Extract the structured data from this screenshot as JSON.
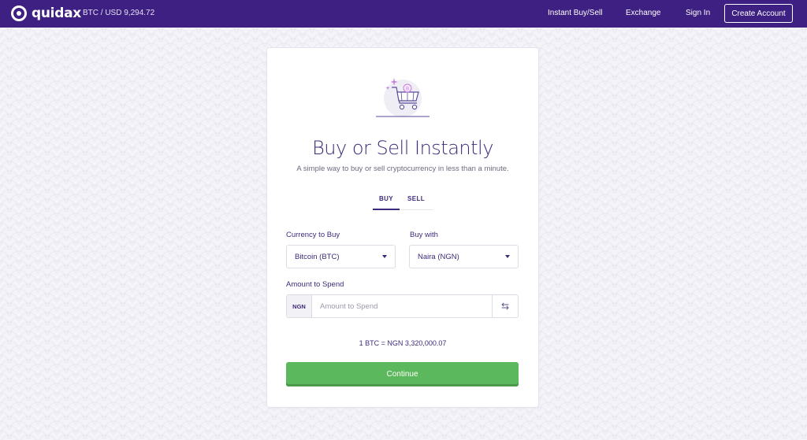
{
  "brand": {
    "name": "quidax"
  },
  "ticker": {
    "text": "BTC / USD 9,294.72"
  },
  "nav": {
    "instant": "Instant Buy/Sell",
    "exchange": "Exchange",
    "signin": "Sign In",
    "create": "Create Account"
  },
  "card": {
    "title": "Buy or Sell Instantly",
    "subtitle": "A simple way to buy or sell cryptocurrency in less than a minute.",
    "tabs": [
      {
        "label": "BUY",
        "active": true
      },
      {
        "label": "SELL",
        "active": false
      }
    ],
    "currency": {
      "label": "Currency to Buy",
      "value": "Bitcoin (BTC)"
    },
    "buy_with": {
      "label": "Buy with",
      "value": "Naira (NGN)"
    },
    "amount": {
      "label": "Amount to Spend",
      "prefix": "NGN",
      "placeholder": "Amount to Spend",
      "value": ""
    },
    "rate": "1 BTC = NGN 3,320,000.07",
    "continue_label": "Continue"
  },
  "colors": {
    "navbar": "#3e1f82",
    "primary_text": "#3e2a7a",
    "continue": "#5cb85c",
    "illustration_accent": "#c77ee0"
  },
  "icons": {
    "brand": "quidax-logo-icon",
    "illustration": "shopping-cart-bitcoin-icon",
    "caret": "chevron-down-icon",
    "swap": "swap-arrows-icon"
  }
}
